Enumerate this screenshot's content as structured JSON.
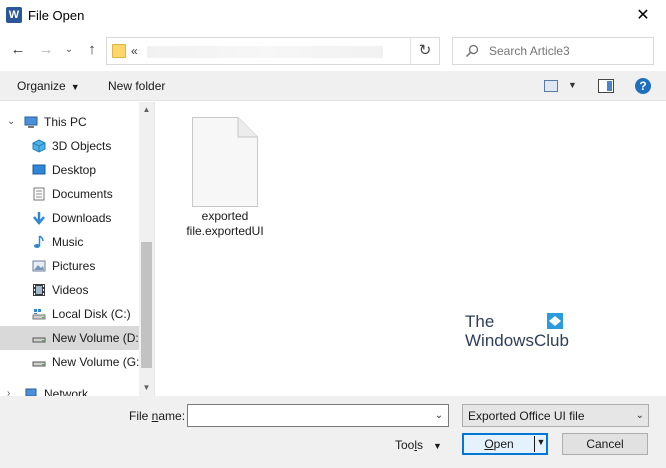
{
  "window": {
    "title": "File Open",
    "app_icon": "word-icon",
    "app_icon_letter": "W",
    "close_glyph": "✕"
  },
  "nav": {
    "back_glyph": "←",
    "forward_glyph": "→",
    "recent_glyph": "⌄",
    "up_glyph": "↑"
  },
  "address": {
    "crumb": "«",
    "refresh_glyph": "↻"
  },
  "search": {
    "placeholder": "Search Article3"
  },
  "toolbar": {
    "organize_label": "Organize",
    "organize_caret": "▼",
    "new_folder_label": "New folder",
    "view_caret": "▼",
    "help_label": "?"
  },
  "sidebar": {
    "items": [
      {
        "label": "This PC",
        "icon": "computer-icon",
        "expander": "⌄"
      },
      {
        "label": "3D Objects",
        "icon": "cube-icon"
      },
      {
        "label": "Desktop",
        "icon": "desktop-icon"
      },
      {
        "label": "Documents",
        "icon": "documents-icon"
      },
      {
        "label": "Downloads",
        "icon": "download-icon"
      },
      {
        "label": "Music",
        "icon": "music-icon"
      },
      {
        "label": "Pictures",
        "icon": "pictures-icon"
      },
      {
        "label": "Videos",
        "icon": "videos-icon"
      },
      {
        "label": "Local Disk (C:)",
        "icon": "drive-icon"
      },
      {
        "label": "New Volume (D:",
        "icon": "drive-icon",
        "selected": true
      },
      {
        "label": "New Volume (G:",
        "icon": "drive-icon"
      },
      {
        "label": "Network",
        "icon": "network-icon",
        "expander": "›"
      }
    ],
    "scroll_up_glyph": "▲",
    "scroll_down_glyph": "▼"
  },
  "files": [
    {
      "line1": "exported",
      "line2": "file.exportedUI",
      "icon": "document-icon"
    }
  ],
  "watermark": {
    "line1": "The",
    "line2": "WindowsClub"
  },
  "footer": {
    "file_name_label_pre": "File ",
    "file_name_label_u": "n",
    "file_name_label_post": "ame:",
    "file_name_value": "",
    "file_name_caret": "⌄",
    "file_type_value": "Exported Office UI file",
    "file_type_caret": "⌄",
    "tools_label_pre": "Too",
    "tools_label_u": "l",
    "tools_label_post": "s",
    "tools_caret": "▼",
    "open_label_u": "O",
    "open_label_post": "pen",
    "open_caret": "▼",
    "cancel_label": "Cancel"
  },
  "colors": {
    "accent": "#0078d7",
    "selection": "#d9d9d9",
    "toolbar_bg": "#f0f0f0"
  }
}
